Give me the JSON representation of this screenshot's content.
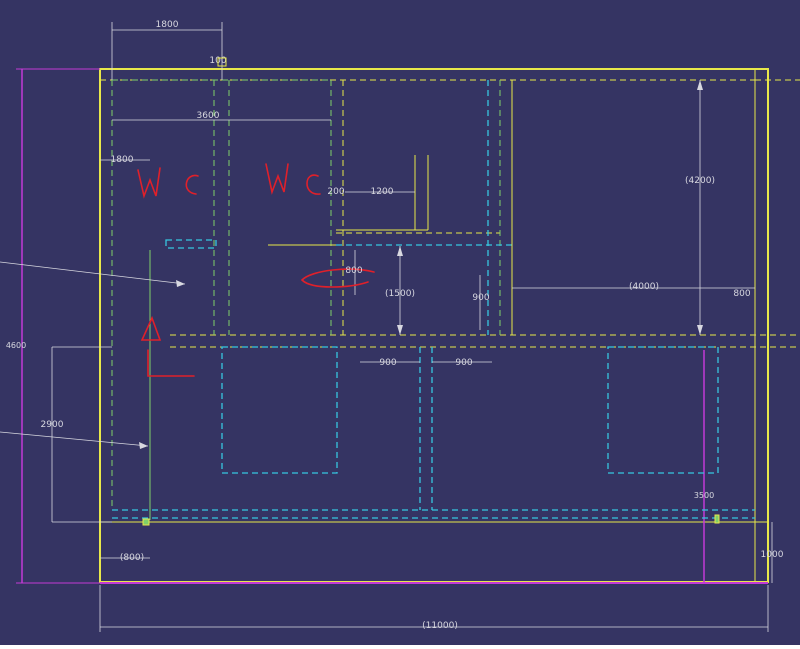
{
  "colors": {
    "background": "#353463",
    "outline": "#e8e84a",
    "dim": "#d8d8e0",
    "cyan": "#36c6e0",
    "green": "#7fd06a",
    "magenta": "#c23ad6",
    "ink": "#e0202a",
    "margin": "#ffffff"
  },
  "dimensions": {
    "top_1800": "1800",
    "top_100": "100",
    "top_3600": "3600",
    "left_1800": "1800",
    "d_200": "200",
    "d_1200": "1200",
    "d_800": "800",
    "d_1500": "(1500)",
    "d_900_vertical": "900",
    "d_4000": "(4000)",
    "d_800_right": "800",
    "d_4200": "(4200)",
    "d_900_a": "900",
    "d_900_b": "900",
    "d_2900": "2900",
    "d_800_bottom": "(800)",
    "d_11000": "(11000)",
    "d_1000": "1000",
    "left_vertical": "4600",
    "right_vertical": "3500"
  },
  "annotations": {
    "wc_left": "W C",
    "wc_right": "W C"
  }
}
